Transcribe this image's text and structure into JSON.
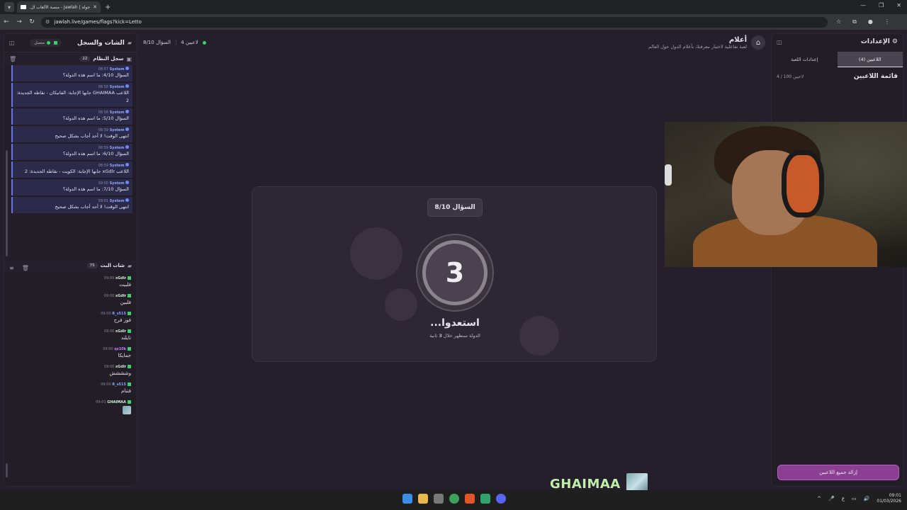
{
  "browser": {
    "tab_title": "جولة | Jawlah - منصة الألعاب ال...",
    "url": "jawlah.live/games/flags?kick=Letto"
  },
  "left_panel": {
    "title": "الشات والسجل",
    "status": "متصل",
    "system_log": {
      "title": "سجل النظام",
      "count": "22",
      "messages": [
        {
          "user": "System",
          "time": "08:57",
          "text": "السؤال 4/10: ما اسم هذه الدولة؟"
        },
        {
          "user": "System",
          "time": "08:58",
          "text": "اللاعب GHAIMAA جابها الإجابة: الفاتيكان - نقاطه الجديدة: 2"
        },
        {
          "user": "System",
          "time": "08:58",
          "text": "السؤال 5/10: ما اسم هذه الدولة؟"
        },
        {
          "user": "System",
          "time": "08:59",
          "text": "انتهى الوقت! لا أحد أجاب بشكل صحيح"
        },
        {
          "user": "System",
          "time": "08:59",
          "text": "السؤال 6/10: ما اسم هذه الدولة؟"
        },
        {
          "user": "System",
          "time": "08:59",
          "text": "اللاعب xGdlr جابها الإجابة: الكويت - نقاطه الجديدة: 2"
        },
        {
          "user": "System",
          "time": "09:00",
          "text": "السؤال 7/10: ما اسم هذه الدولة؟"
        },
        {
          "user": "System",
          "time": "09:01",
          "text": "انتهى الوقت! لا أحد أجاب بشكل صحيح"
        }
      ]
    },
    "live_chat": {
      "title": "شات البث",
      "count": "75",
      "messages": [
        {
          "user": "xGdlr",
          "time": "09:00",
          "text": "فلبيت",
          "color": "green"
        },
        {
          "user": "xGdlr",
          "time": "09:00",
          "text": "فلبين",
          "color": "green"
        },
        {
          "user": "R_s515",
          "time": "09:00",
          "text": "فوز فرح",
          "color": "blue"
        },
        {
          "user": "xGdlr",
          "time": "09:00",
          "text": "تايلند",
          "color": "green"
        },
        {
          "user": "qz10k",
          "time": "09:00",
          "text": "جمايكا",
          "color": "purple"
        },
        {
          "user": "xGdlr",
          "time": "09:00",
          "text": "وشششش",
          "color": "green"
        },
        {
          "user": "R_s515",
          "time": "09:00",
          "text": "فتنام",
          "color": "blue"
        },
        {
          "user": "GHAIMAA",
          "time": "09:01",
          "text": "",
          "color": "green"
        }
      ]
    }
  },
  "game_header": {
    "players": "4 لاعبين",
    "question": "السؤال 8/10",
    "title": "أعلام",
    "subtitle": "لعبة تفاعلية لاختبار معرفتك بأعلام الدول حول العالم"
  },
  "game_card": {
    "question_badge": "السؤال 8/10",
    "countdown": "3",
    "ready_text": "استعدوا...",
    "ready_sub_prefix": "الدولة ستظهر خلال",
    "ready_sub_seconds": "3",
    "ready_sub_suffix": "ثانية"
  },
  "right_panel": {
    "title": "الإعدادات",
    "tabs": [
      {
        "label": "اللاعبين (4)",
        "active": true
      },
      {
        "label": "إعدادات اللعبة",
        "active": false
      }
    ],
    "players_title": "قائمة اللاعبين",
    "players_count": "4 / 100 لاعبين",
    "remove_all": "إزالة جميع اللاعبين"
  },
  "overlay": {
    "streamer_name": "GHAIMAA"
  },
  "taskbar": {
    "time": "09:01",
    "date": "01/03/2026",
    "lang": "ع"
  },
  "colors": {
    "accent": "#8b3f93",
    "system_border": "#6a76e0",
    "kick_green": "#39d16b"
  }
}
